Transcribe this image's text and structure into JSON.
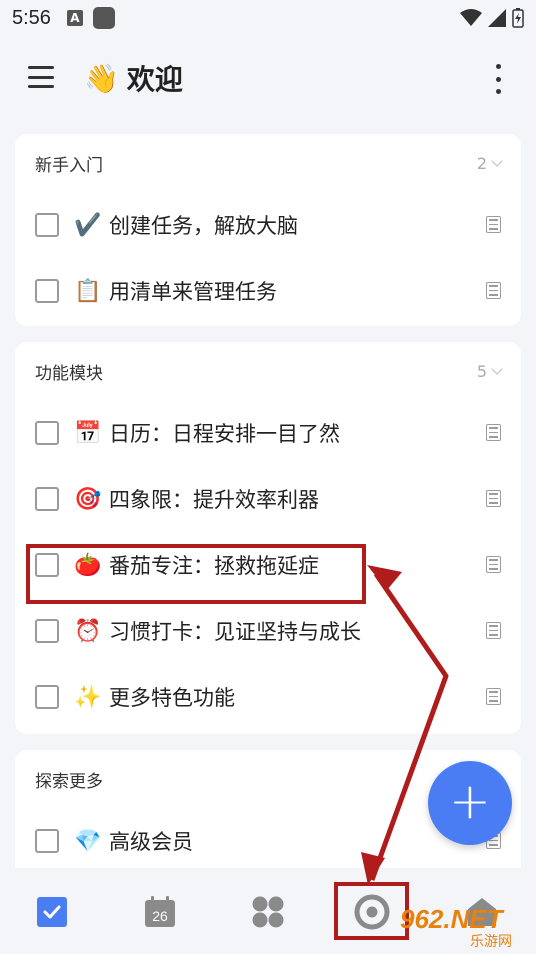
{
  "status_bar": {
    "time": "5:56",
    "a_badge": "A"
  },
  "app": {
    "title_emoji": "👋",
    "title": "欢迎"
  },
  "sections": [
    {
      "title": "新手入门",
      "count": "2",
      "tasks": [
        {
          "emoji": "✔️",
          "text": "创建任务，解放大脑"
        },
        {
          "emoji": "📋",
          "text": "用清单来管理任务"
        }
      ]
    },
    {
      "title": "功能模块",
      "count": "5",
      "tasks": [
        {
          "emoji": "📅",
          "text": "日历：日程安排一目了然"
        },
        {
          "emoji": "🎯",
          "text": "四象限：提升效率利器"
        },
        {
          "emoji": "🍅",
          "text": "番茄专注：拯救拖延症"
        },
        {
          "emoji": "⏰",
          "text": "习惯打卡：见证坚持与成长"
        },
        {
          "emoji": "✨",
          "text": "更多特色功能"
        }
      ]
    },
    {
      "title": "探索更多",
      "tasks": [
        {
          "emoji": "💎",
          "text": "高级会员"
        }
      ]
    }
  ],
  "fab": {
    "label": "+"
  },
  "bottom_nav": {
    "items": [
      {
        "icon": "task-check-icon",
        "active": true
      },
      {
        "icon": "calendar-icon",
        "date": "26"
      },
      {
        "icon": "four-quadrant-icon"
      },
      {
        "icon": "pomodoro-timer-icon"
      },
      {
        "icon": "habit-icon"
      }
    ]
  },
  "watermark": {
    "logo": "962.NET",
    "sub": "乐游网"
  },
  "colors": {
    "accent": "#4a7df4",
    "annotation_red": "#b01c1c"
  }
}
